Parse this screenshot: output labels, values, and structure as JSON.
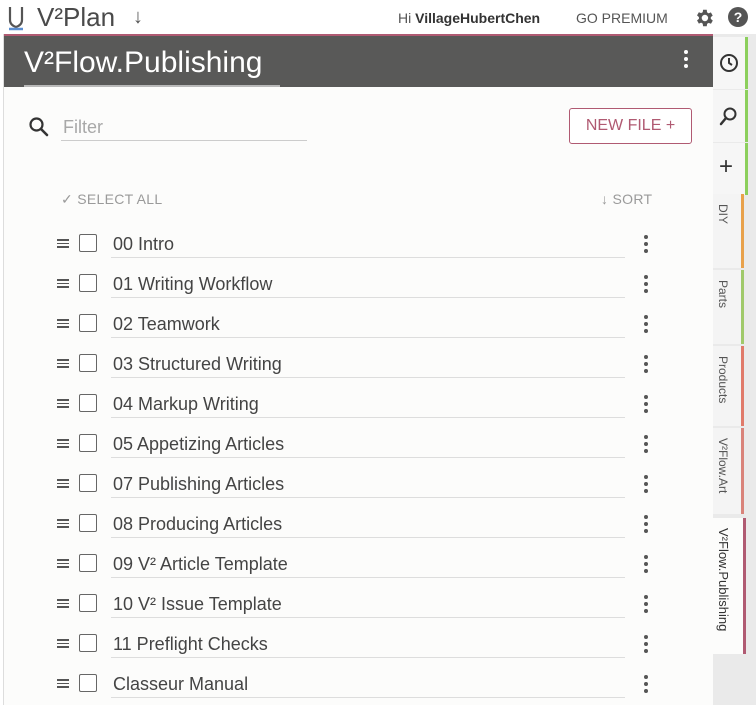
{
  "app": {
    "brand": "V²Plan",
    "greeting_prefix": "Hi ",
    "user_name": "VillageHubertChen",
    "premium_label": "GO PREMIUM"
  },
  "panel": {
    "title": "V²Flow.Publishing",
    "filter_placeholder": "Filter",
    "filter_value": "",
    "new_file_label": "NEW FILE +",
    "select_all_label": "✓ SELECT ALL",
    "sort_label": "↓ SORT"
  },
  "files": [
    {
      "name": "00 Intro"
    },
    {
      "name": "01 Writing Workflow"
    },
    {
      "name": "02 Teamwork"
    },
    {
      "name": "03 Structured Writing"
    },
    {
      "name": "04 Markup Writing"
    },
    {
      "name": "05 Appetizing Articles"
    },
    {
      "name": "07 Publishing Articles"
    },
    {
      "name": "08 Producing Articles"
    },
    {
      "name": "09 V² Article Template"
    },
    {
      "name": "10 V² Issue Template"
    },
    {
      "name": "11 Preflight Checks"
    },
    {
      "name": "Classeur Manual"
    }
  ],
  "sidebar": {
    "tools": [
      {
        "icon": "clock-icon",
        "color": "#8ccf5c"
      },
      {
        "icon": "search-icon",
        "color": "#8ccf5c"
      },
      {
        "icon": "plus-icon",
        "label": "+",
        "color": "#8ccf5c"
      }
    ],
    "projects": [
      {
        "label": "DIY",
        "color": "#e8a14b"
      },
      {
        "label": "Parts",
        "color": "#a0c96a"
      },
      {
        "label": "Products",
        "color": "#e07a6a"
      },
      {
        "label": "V²Flow.Art",
        "color": "#d9837a"
      },
      {
        "label": "V²Flow.Publishing",
        "color": "#b05a72",
        "active": true
      }
    ]
  },
  "colors": {
    "accent": "#b05a72",
    "header_bg": "#595958",
    "tool_tab_accent": "#8ccf5c"
  }
}
